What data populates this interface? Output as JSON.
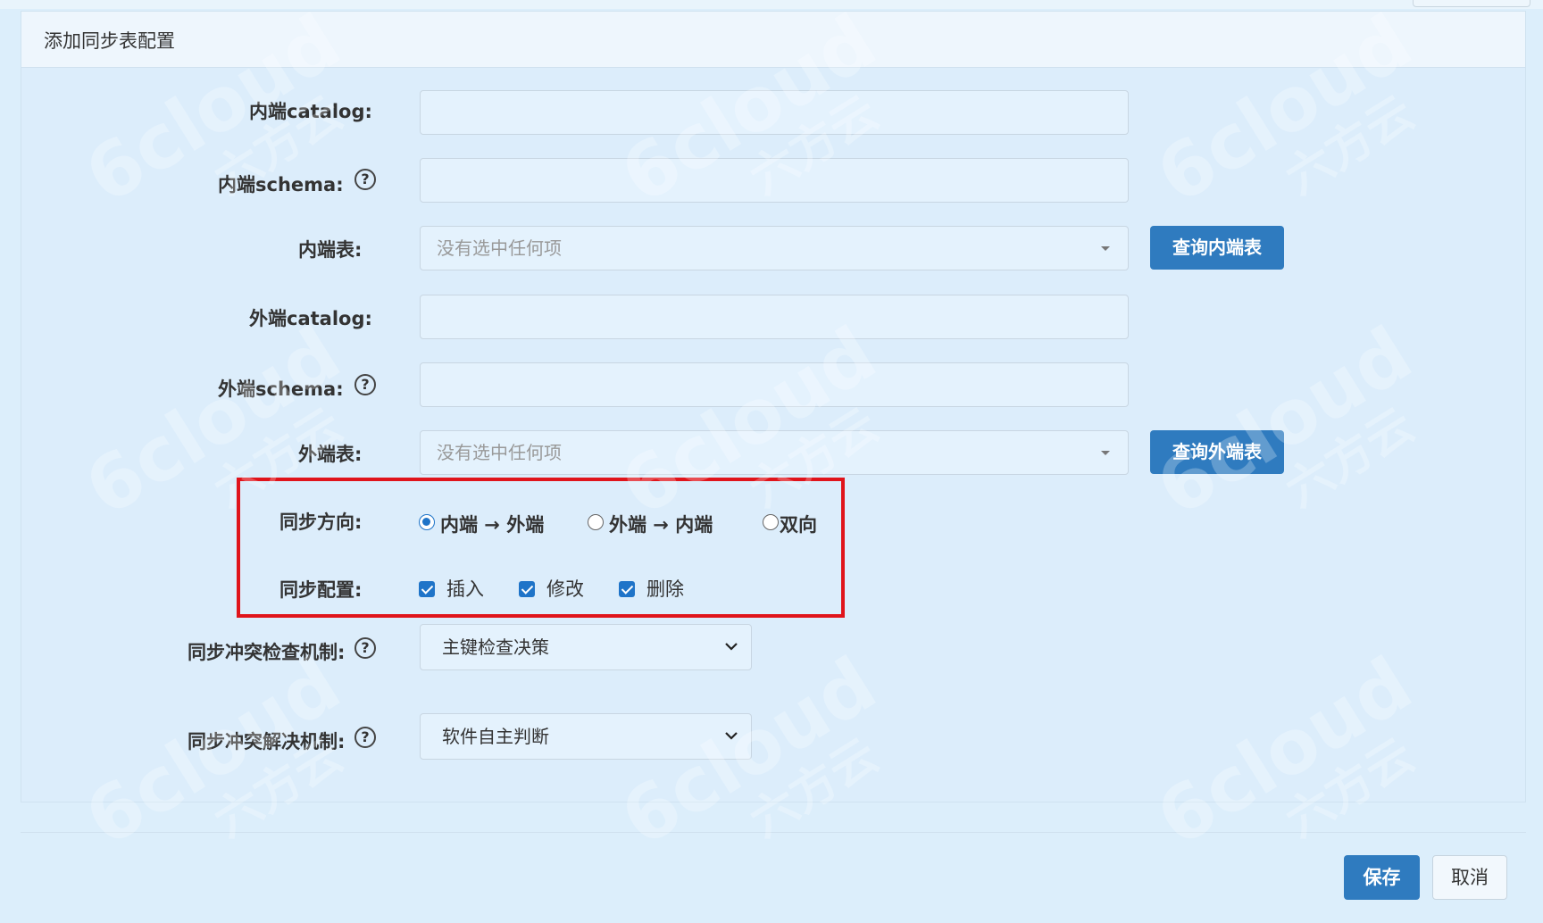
{
  "panel": {
    "title": "添加同步表配置"
  },
  "form": {
    "inner_catalog_label": "内端catalog:",
    "inner_schema_label": "内端schema:",
    "inner_table_label": "内端表:",
    "inner_table_placeholder": "没有选中任何项",
    "query_inner_button": "查询内端表",
    "outer_catalog_label": "外端catalog:",
    "outer_schema_label": "外端schema:",
    "outer_table_label": "外端表:",
    "outer_table_placeholder": "没有选中任何项",
    "query_outer_button": "查询外端表",
    "help_glyph": "?",
    "sync_direction": {
      "label": "同步方向:",
      "options": [
        {
          "label": "内端 → 外端",
          "checked": true
        },
        {
          "label": "外端 → 内端",
          "checked": false
        },
        {
          "label": "双向",
          "checked": false
        }
      ]
    },
    "sync_config": {
      "label": "同步配置:",
      "options": [
        {
          "label": "插入",
          "checked": true
        },
        {
          "label": "修改",
          "checked": true
        },
        {
          "label": "删除",
          "checked": true
        }
      ]
    },
    "conflict_check": {
      "label": "同步冲突检查机制:",
      "value": "主键检查决策"
    },
    "conflict_resolve": {
      "label": "同步冲突解决机制:",
      "value": "软件自主判断"
    }
  },
  "footer": {
    "save": "保存",
    "cancel": "取消"
  },
  "watermark": {
    "text": "6cloud",
    "subtext": "六方云"
  },
  "colors": {
    "primary": "#2f7bbf",
    "highlight": "#e0141b",
    "background": "#dceefb"
  }
}
